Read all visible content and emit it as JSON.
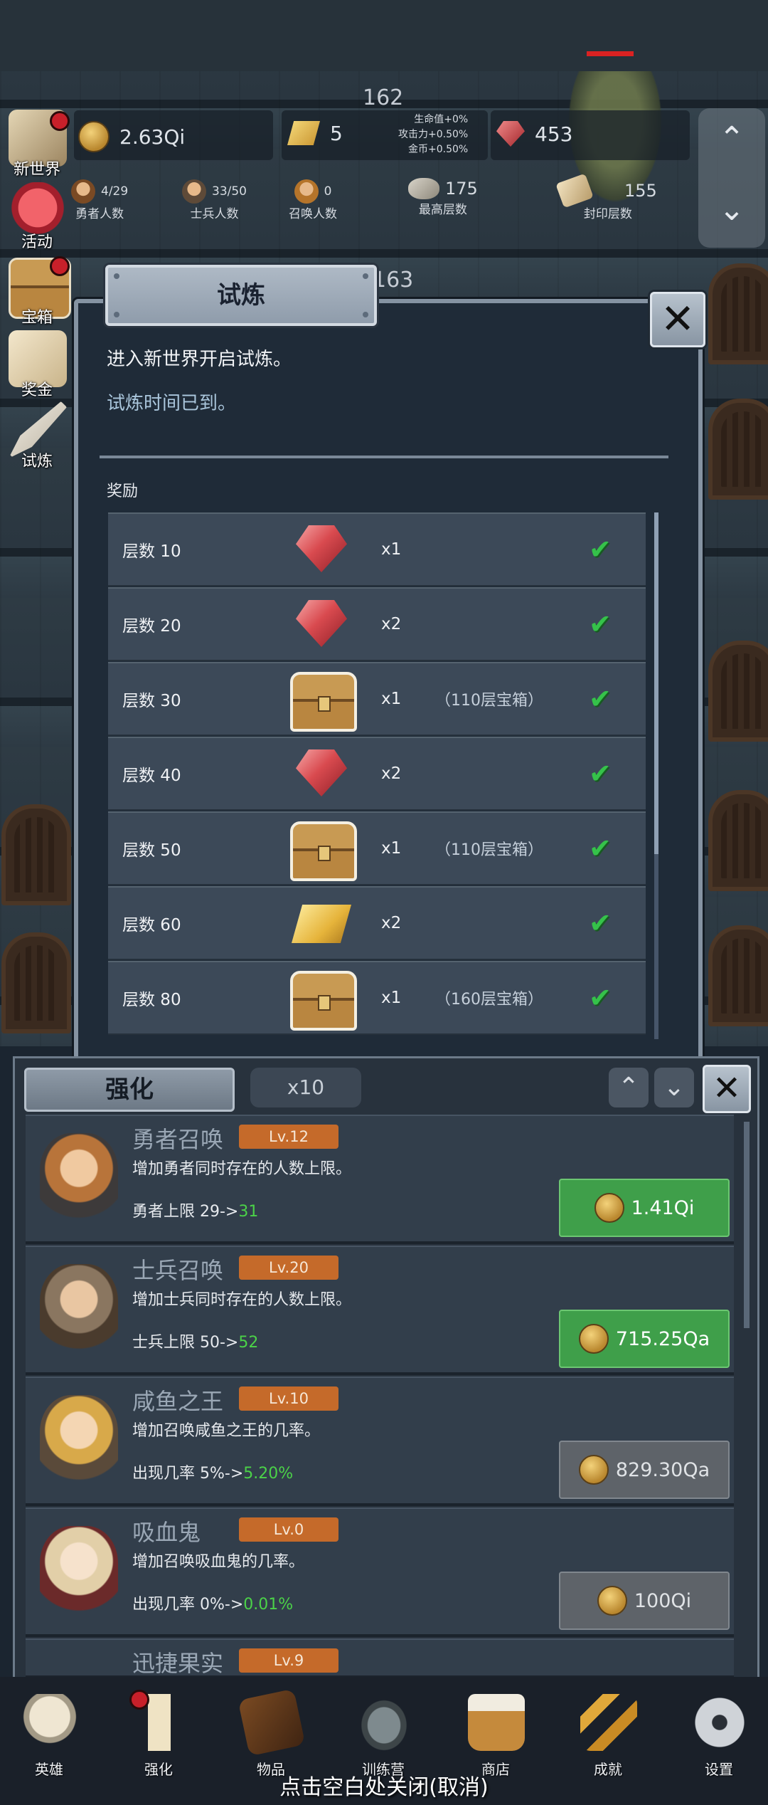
{
  "hud": {
    "floor_top": "162",
    "floor_behind": "163",
    "coins": "2.63Qi",
    "gold_bars": "5",
    "gems": "453",
    "bonuses": [
      "生命值+0%",
      "攻击力+0.50%",
      "金币+0.50%"
    ],
    "stats": [
      {
        "value": "4/29",
        "label": "勇者人数"
      },
      {
        "value": "33/50",
        "label": "士兵人数"
      },
      {
        "value": "0",
        "label": "召唤人数"
      },
      {
        "value": "175",
        "label": "最高层数"
      },
      {
        "value": "155",
        "label": "封印层数"
      }
    ]
  },
  "side_menu": [
    {
      "label": "新世界",
      "icon": "map-icon",
      "badge": true
    },
    {
      "label": "活动",
      "icon": "heart-icon",
      "badge": false
    },
    {
      "label": "宝箱",
      "icon": "chest-icon",
      "badge": true
    },
    {
      "label": "奖金",
      "icon": "envelope-icon",
      "badge": false
    },
    {
      "label": "试炼",
      "icon": "quill-icon",
      "badge": false
    }
  ],
  "trial_dialog": {
    "title": "试炼",
    "line1": "进入新世界开启试炼。",
    "line2": "试炼时间已到。",
    "reward_label": "奖励",
    "rewards": [
      {
        "level": "层数 10",
        "item": "gem-icon",
        "qty": "x1",
        "note": "",
        "claimed": true
      },
      {
        "level": "层数 20",
        "item": "gem-icon",
        "qty": "x2",
        "note": "",
        "claimed": true
      },
      {
        "level": "层数 30",
        "item": "chest-icon",
        "qty": "x1",
        "note": "（110层宝箱）",
        "claimed": true
      },
      {
        "level": "层数 40",
        "item": "gem-icon",
        "qty": "x2",
        "note": "",
        "claimed": true
      },
      {
        "level": "层数 50",
        "item": "chest-icon",
        "qty": "x1",
        "note": "（110层宝箱）",
        "claimed": true
      },
      {
        "level": "层数 60",
        "item": "gold-bar-icon",
        "qty": "x2",
        "note": "",
        "claimed": true
      },
      {
        "level": "层数 80",
        "item": "chest-icon",
        "qty": "x1",
        "note": "（160层宝箱）",
        "claimed": true
      }
    ]
  },
  "enhance_panel": {
    "tab_label": "强化",
    "multiplier": "x10",
    "upgrades": [
      {
        "name": "勇者召唤",
        "level": "Lv.12",
        "desc": "增加勇者同时存在的人数上限。",
        "effect_prefix": "勇者上限 29->",
        "effect_new": "31",
        "cost": "1.41Qi",
        "affordable": true,
        "portrait_color": "#b8743a"
      },
      {
        "name": "士兵召唤",
        "level": "Lv.20",
        "desc": "增加士兵同时存在的人数上限。",
        "effect_prefix": "士兵上限 50->",
        "effect_new": "52",
        "cost": "715.25Qa",
        "affordable": true,
        "portrait_color": "#8a7660"
      },
      {
        "name": "咸鱼之王",
        "level": "Lv.10",
        "desc": "增加召唤咸鱼之王的几率。",
        "effect_prefix": "出现几率 5%->",
        "effect_new": "5.20%",
        "cost": "829.30Qa",
        "affordable": false,
        "portrait_color": "#d8a94a"
      },
      {
        "name": "吸血鬼",
        "level": "Lv.0",
        "desc": "增加召唤吸血鬼的几率。",
        "effect_prefix": "出现几率 0%->",
        "effect_new": "0.01%",
        "cost": "100Qi",
        "affordable": false,
        "portrait_color": "#e2cfa8"
      },
      {
        "name": "迅捷果实",
        "level": "Lv.9",
        "desc": "",
        "effect_prefix": "",
        "effect_new": "",
        "cost": "",
        "affordable": false,
        "portrait_color": "#7a8a4a"
      }
    ]
  },
  "bottom_nav": [
    {
      "label": "英雄",
      "icon": "skull-icon",
      "badge": false
    },
    {
      "label": "强化",
      "icon": "candle-icon",
      "badge": true
    },
    {
      "label": "物品",
      "icon": "book-icon",
      "badge": false
    },
    {
      "label": "训练营",
      "icon": "lantern-icon",
      "badge": false
    },
    {
      "label": "商店",
      "icon": "beer-mug-icon",
      "badge": false
    },
    {
      "label": "成就",
      "icon": "key-icon",
      "badge": false
    },
    {
      "label": "设置",
      "icon": "gear-icon",
      "badge": false
    }
  ],
  "close_hint": "点击空白处关闭(取消)",
  "colors": {
    "accent_green": "#4bd248",
    "level_badge": "#c56a2a",
    "buy_enabled": "#3f9f4a",
    "check_green": "#35c24a"
  }
}
